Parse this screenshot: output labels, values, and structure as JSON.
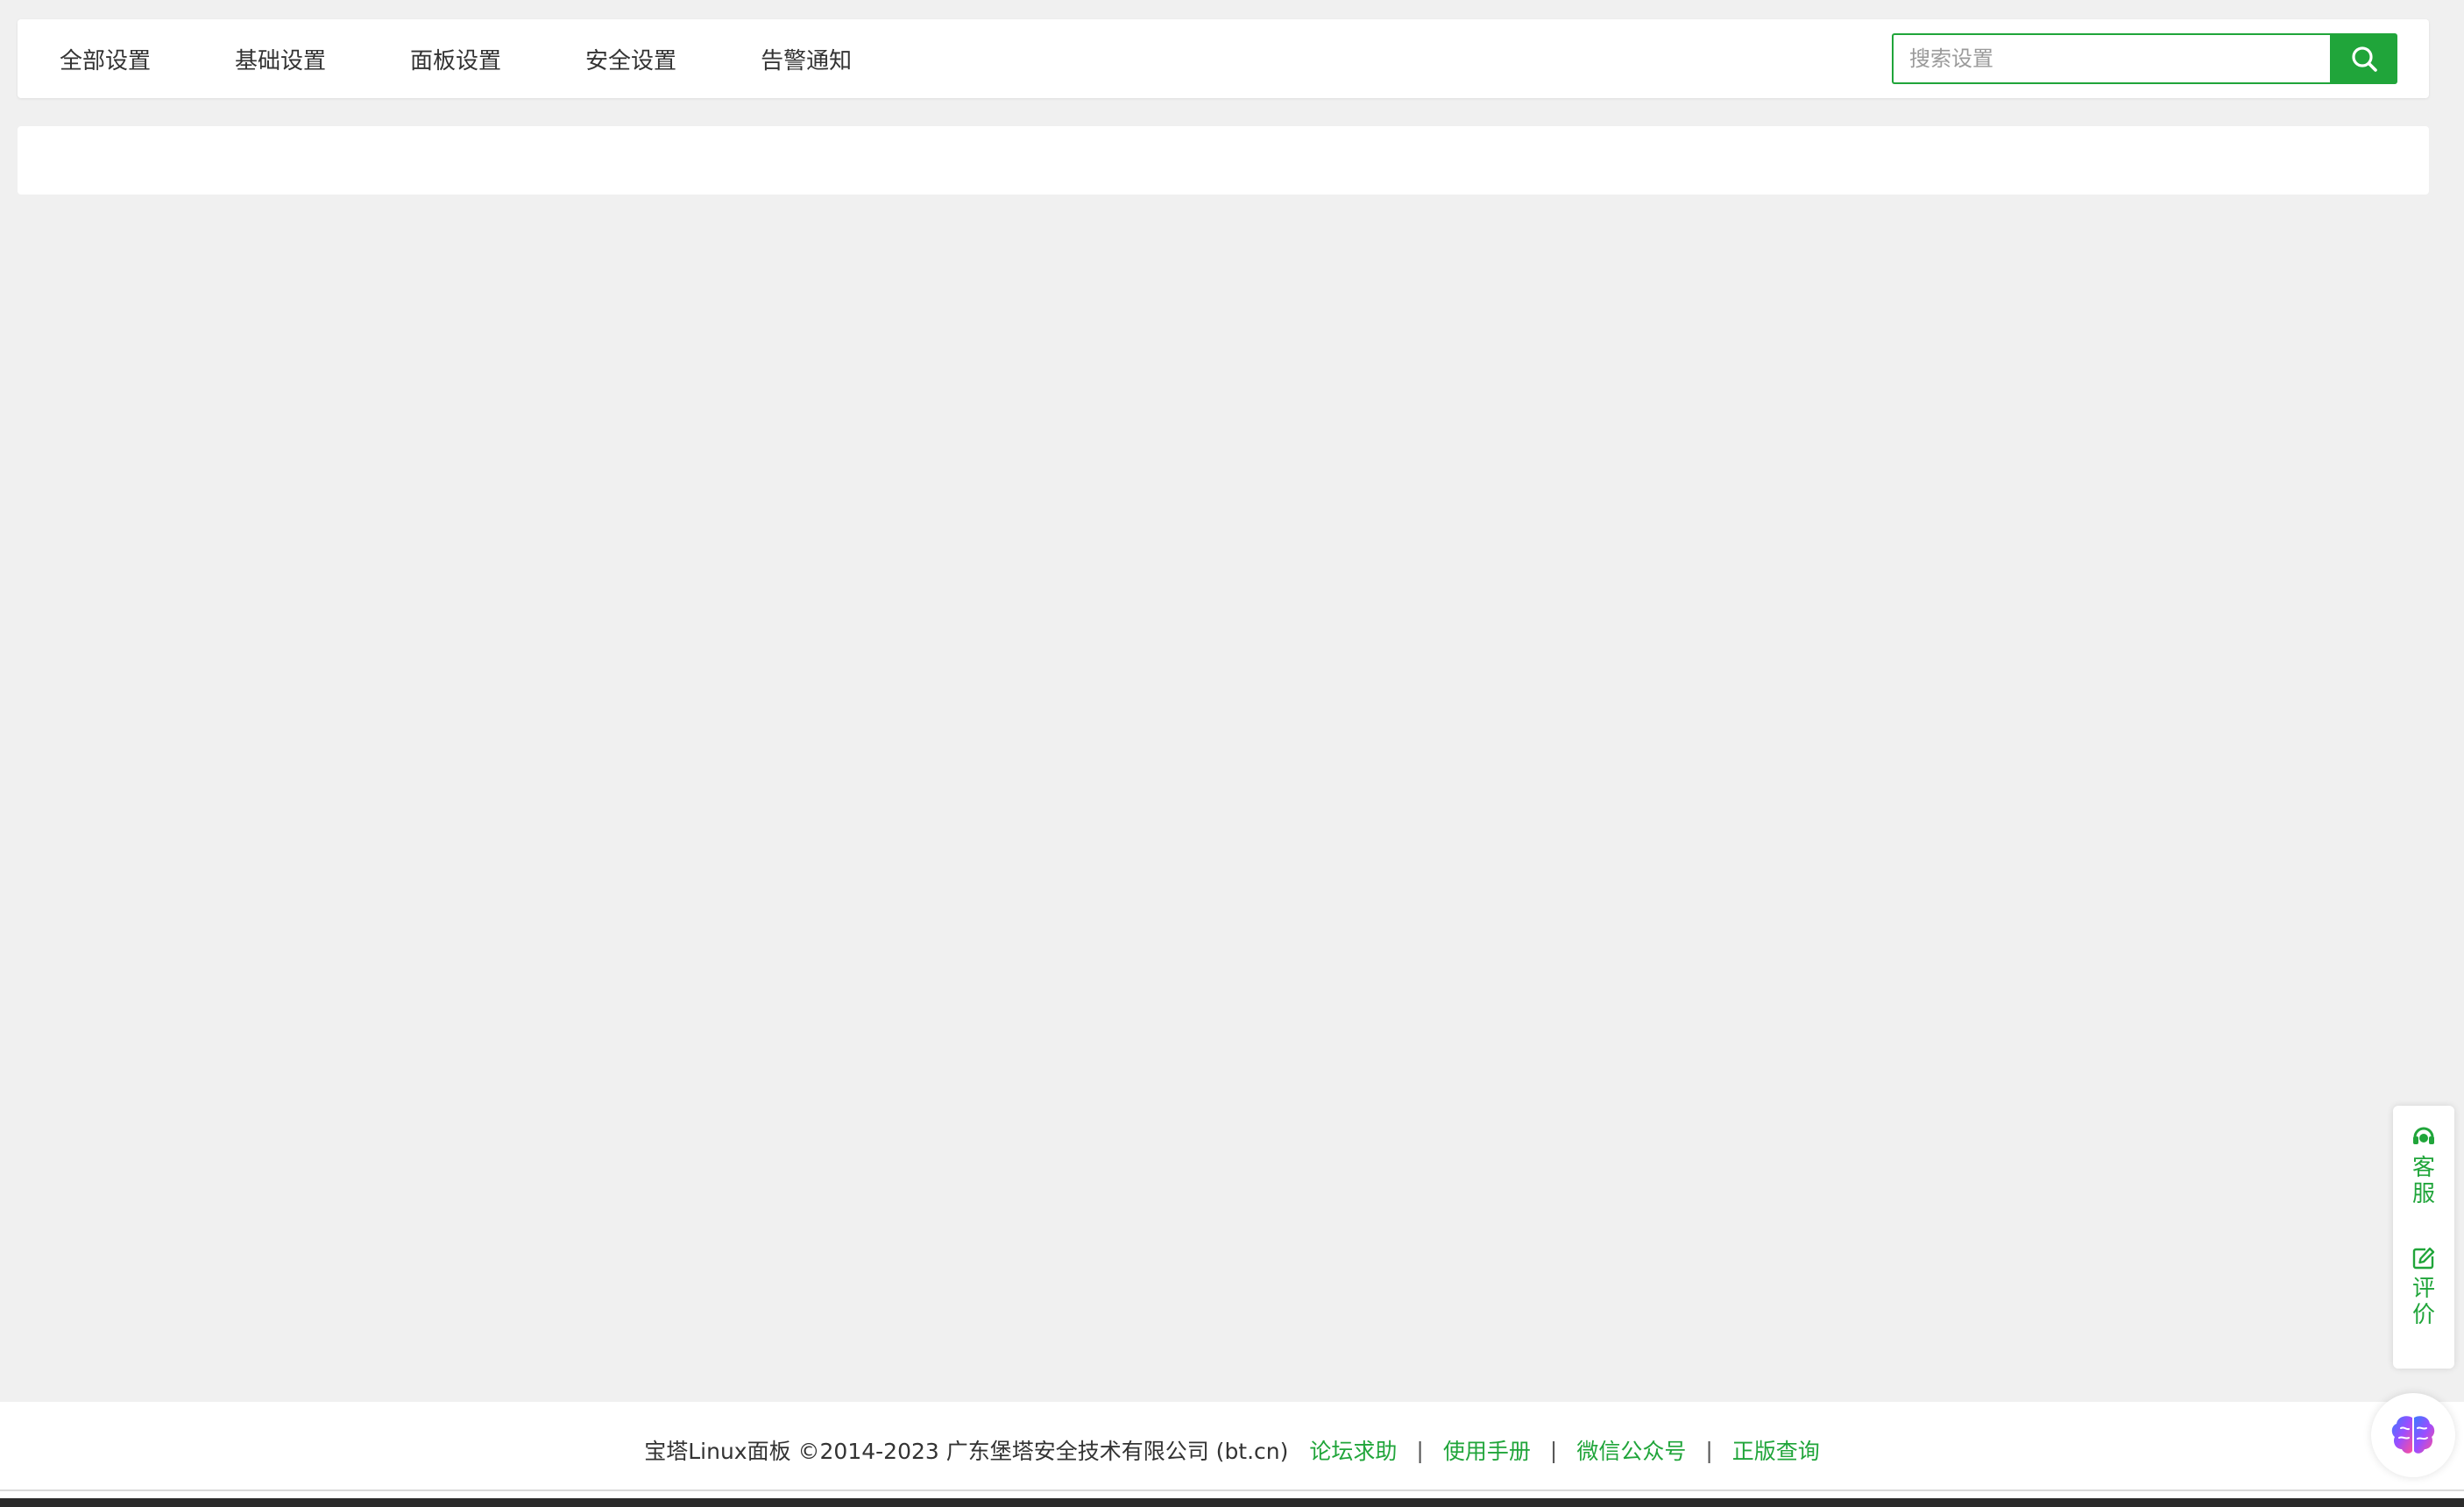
{
  "tabs": [
    {
      "label": "全部设置"
    },
    {
      "label": "基础设置"
    },
    {
      "label": "面板设置"
    },
    {
      "label": "安全设置"
    },
    {
      "label": "告警通知"
    }
  ],
  "search": {
    "placeholder": "搜索设置",
    "value": "",
    "button_icon": "search-icon"
  },
  "float_tools": {
    "service": {
      "icon": "headset-icon",
      "chars": [
        "客",
        "服"
      ]
    },
    "review": {
      "icon": "edit-icon",
      "chars": [
        "评",
        "价"
      ]
    }
  },
  "footer": {
    "copyright": "宝塔Linux面板 ©2014-2023 广东堡塔安全技术有限公司 (bt.cn)",
    "links": [
      "论坛求助",
      "使用手册",
      "微信公众号",
      "正版查询"
    ],
    "separator": "|"
  },
  "assistant": {
    "icon": "brain-icon"
  },
  "colors": {
    "accent": "#20a53a",
    "background": "#f0f0f0",
    "panel": "#ffffff"
  }
}
